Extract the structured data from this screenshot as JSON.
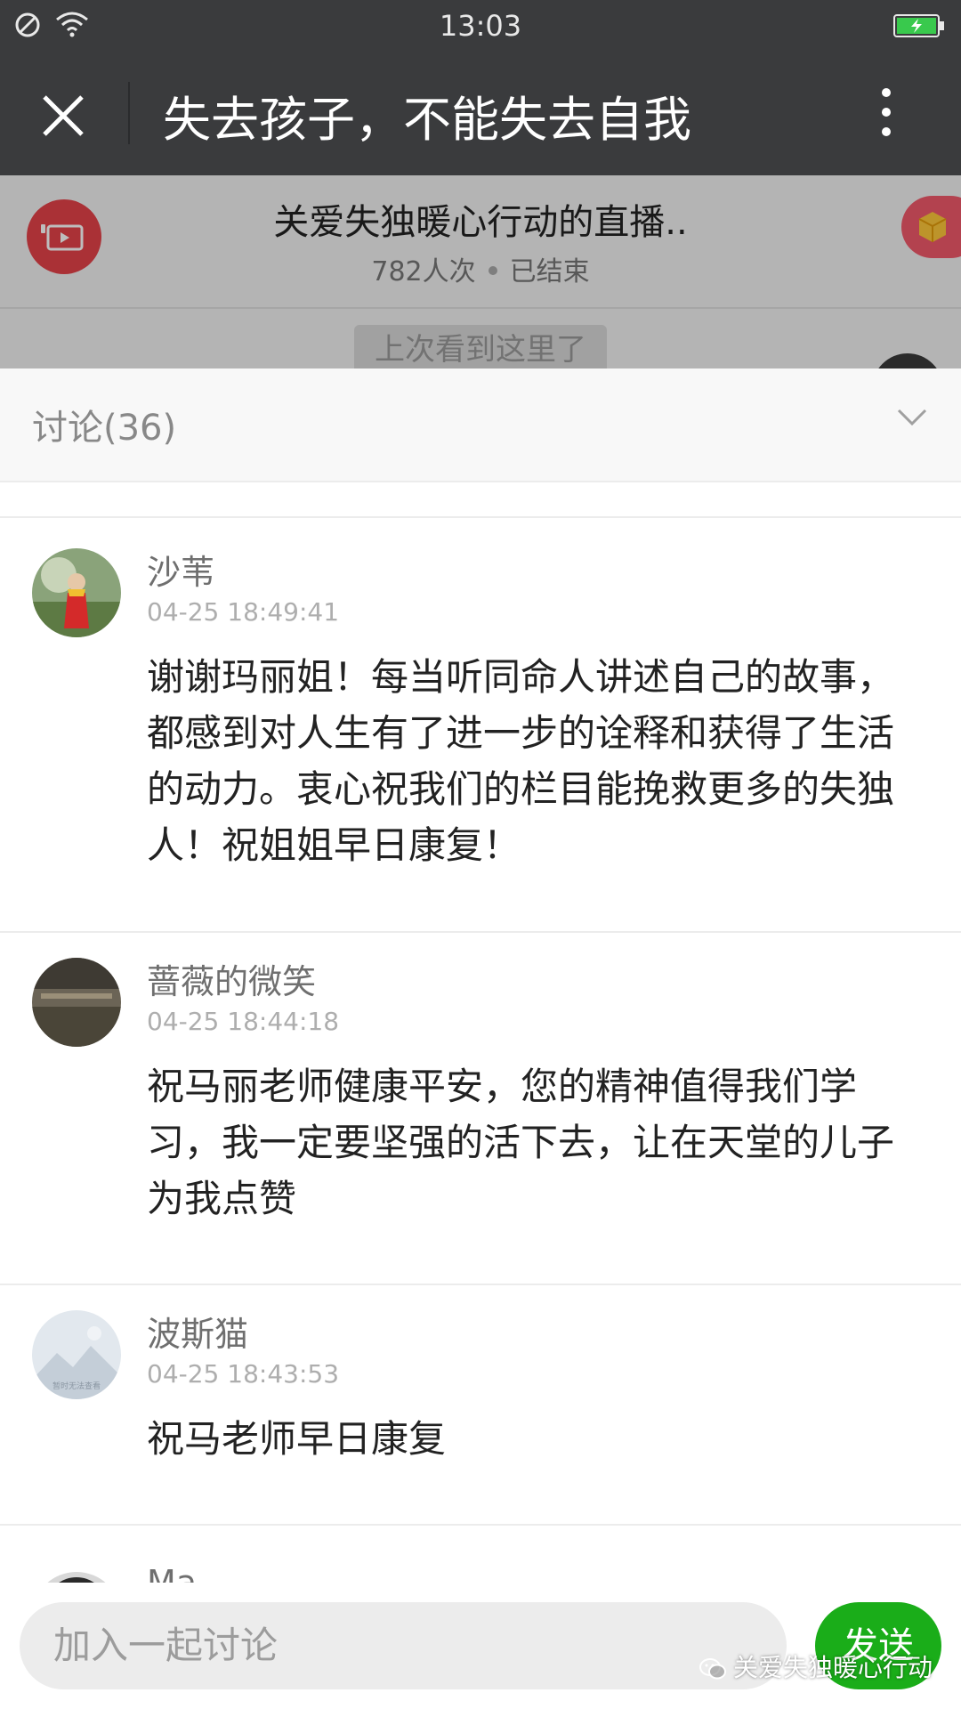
{
  "status_bar": {
    "time": "13:03"
  },
  "nav": {
    "title": "失去孩子，不能失去自我"
  },
  "live": {
    "title": "关爱失独暖心行动的直播..",
    "viewers": "782人次",
    "state": "已结束",
    "last_seen_label": "上次看到这里了"
  },
  "discussion": {
    "header": "讨论(36)",
    "comments": [
      {
        "name": "沙苇",
        "time": "04-25 18:49:41",
        "text": "谢谢玛丽姐！每当听同命人讲述自己的故事，都感到对人生有了进一步的诠释和获得了生活的动力。衷心祝我们的栏目能挽救更多的失独人！祝姐姐早日康复！"
      },
      {
        "name": "蔷薇的微笑",
        "time": "04-25 18:44:18",
        "text": "祝马丽老师健康平安，您的精神值得我们学习，我一定要坚强的活下去，让在天堂的儿子为我点赞"
      },
      {
        "name": "波斯猫",
        "time": "04-25 18:43:53",
        "text": "祝马老师早日康复",
        "avatar_caption": "暂时无法查看"
      },
      {
        "name": "Ma"
      }
    ]
  },
  "input": {
    "placeholder": "加入一起讨论",
    "send_label": "发送"
  },
  "watermark": {
    "text": "关爱失独暖心行动"
  },
  "colors": {
    "bar": "#3a3b3d",
    "send": "#1aad19",
    "live_icon": "#e6434a",
    "gift": "#f25a6b"
  }
}
